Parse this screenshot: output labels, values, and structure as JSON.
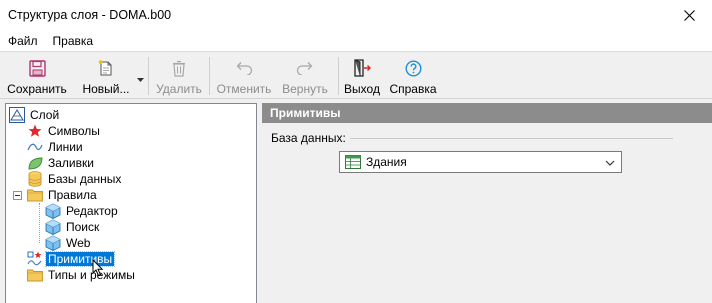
{
  "window": {
    "title": "Структура слоя - DOMA.b00"
  },
  "menu": [
    {
      "label": "Файл"
    },
    {
      "label": "Правка"
    }
  ],
  "toolbar": {
    "save_label": "Сохранить",
    "new_label": "Новый...",
    "delete_label": "Удалить",
    "undo_label": "Отменить",
    "redo_label": "Вернуть",
    "exit_label": "Выход",
    "help_label": "Справка"
  },
  "tree": {
    "root": "Слой",
    "items": [
      {
        "label": "Символы",
        "icon": "star-icon"
      },
      {
        "label": "Линии",
        "icon": "line-icon"
      },
      {
        "label": "Заливки",
        "icon": "fill-leaf-icon"
      },
      {
        "label": "Базы данных",
        "icon": "database-icon"
      },
      {
        "label": "Правила",
        "icon": "folder-icon"
      },
      {
        "label": "Редактор",
        "icon": "cube-icon"
      },
      {
        "label": "Поиск",
        "icon": "cube-icon"
      },
      {
        "label": "Web",
        "icon": "cube-icon"
      },
      {
        "label": "Примитивы",
        "icon": "primitives-icon"
      },
      {
        "label": "Типы и режимы",
        "icon": "folder-icon"
      }
    ],
    "selected": "Примитивы"
  },
  "panel": {
    "header": "Примитивы",
    "db_label": "База данных:",
    "db_value": "Здания"
  },
  "colors": {
    "selection": "#0078d7",
    "panel_header": "#8c8c8c",
    "save_icon": "#b0366e",
    "help_icon": "#1e8fd6",
    "folder": "#f5c85a",
    "cube": "#4aa3df",
    "star": "#e0282c",
    "fill_leaf": "#7cc26f"
  }
}
